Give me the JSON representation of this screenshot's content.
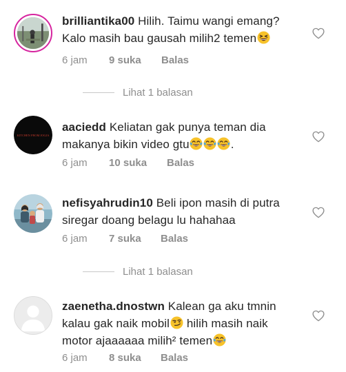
{
  "comments": [
    {
      "username": "brilliantika00",
      "text_before": "Hilih. Taimu wangi emang? Kalo masih bau gausah milih2 temen",
      "text_after": "",
      "time": "6 jam",
      "likes": "9 suka",
      "reply": "Balas"
    },
    {
      "username": "aaciedd",
      "text_before": "Keliatan gak punya teman dia makanya bikin video gtu",
      "text_after": ".",
      "time": "6 jam",
      "likes": "10 suka",
      "reply": "Balas"
    },
    {
      "username": "nefisyahrudin10",
      "text_before": "Beli ipon masih di putra siregar doang belagu lu hahahaa",
      "text_after": "",
      "time": "6 jam",
      "likes": "7 suka",
      "reply": "Balas"
    },
    {
      "username": "zaenetha.dnostwn",
      "text_before": "Kalean ga aku tmnin kalau gak naik mobil",
      "text_mid": " hilih masih naik motor ajaaaaaa milih² temen",
      "text_after": "",
      "time": "6 jam",
      "likes": "8 suka",
      "reply": "Balas"
    }
  ],
  "view_replies": [
    {
      "label": "Lihat 1 balasan"
    },
    {
      "label": "Lihat 1 balasan"
    }
  ],
  "avatar2_text": "KITCHEN FROM JOGJA",
  "icons": {
    "heart": "heart-outline-icon",
    "laugh": "grinning-squinting-face-icon",
    "tears": "face-with-tears-of-joy-icon",
    "smirk": "smirking-face-icon"
  },
  "colors": {
    "meta_gray": "#8e8e8e",
    "text": "#262626",
    "story_ring": "#d6249f"
  }
}
